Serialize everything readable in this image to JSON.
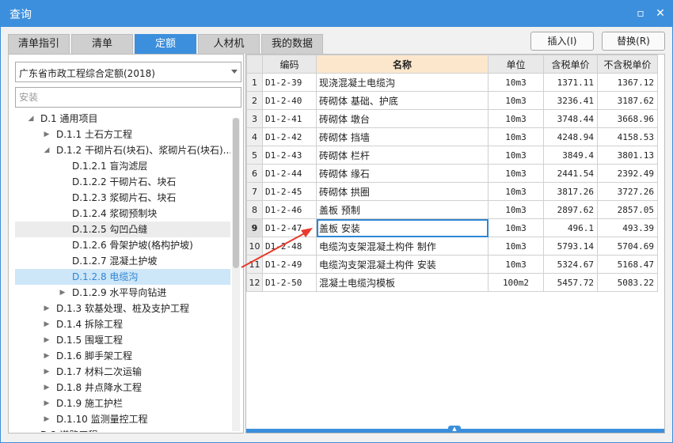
{
  "window": {
    "title": "查询",
    "minimize_glyph": "▫",
    "close_glyph": "✕"
  },
  "tabs": [
    "清单指引",
    "清单",
    "定额",
    "人材机",
    "我的数据"
  ],
  "active_tab": "定额",
  "buttons": {
    "insert": "插入(I)",
    "replace": "替换(R)"
  },
  "quota_library": {
    "selected": "广东省市政工程综合定额(2018)"
  },
  "search": {
    "placeholder": "安装",
    "value": ""
  },
  "tree": [
    {
      "label": "D.1 通用项目",
      "level": 0,
      "toggle": "expanded"
    },
    {
      "label": "D.1.1 土石方工程",
      "level": 1,
      "toggle": "collapsed"
    },
    {
      "label": "D.1.2 干砌片石(块石)、浆砌片石(块石)...",
      "level": 1,
      "toggle": "expanded"
    },
    {
      "label": "D.1.2.1 盲沟滤层",
      "level": 2,
      "toggle": "none"
    },
    {
      "label": "D.1.2.2 干砌片石、块石",
      "level": 2,
      "toggle": "none"
    },
    {
      "label": "D.1.2.3 浆砌片石、块石",
      "level": 2,
      "toggle": "none"
    },
    {
      "label": "D.1.2.4 浆砌预制块",
      "level": 2,
      "toggle": "none"
    },
    {
      "label": "D.1.2.5 勾凹凸缝",
      "level": 2,
      "toggle": "none",
      "state": "hover"
    },
    {
      "label": "D.1.2.6 骨架护坡(格构护坡)",
      "level": 2,
      "toggle": "none"
    },
    {
      "label": "D.1.2.7 混凝土护坡",
      "level": 2,
      "toggle": "none"
    },
    {
      "label": "D.1.2.8 电缆沟",
      "level": 2,
      "toggle": "none",
      "state": "selected"
    },
    {
      "label": "D.1.2.9 水平导向钻进",
      "level": 2,
      "toggle": "collapsed"
    },
    {
      "label": "D.1.3 软基处理、桩及支护工程",
      "level": 1,
      "toggle": "collapsed"
    },
    {
      "label": "D.1.4 拆除工程",
      "level": 1,
      "toggle": "collapsed"
    },
    {
      "label": "D.1.5 围堰工程",
      "level": 1,
      "toggle": "collapsed"
    },
    {
      "label": "D.1.6 脚手架工程",
      "level": 1,
      "toggle": "collapsed"
    },
    {
      "label": "D.1.7 材料二次运输",
      "level": 1,
      "toggle": "collapsed"
    },
    {
      "label": "D.1.8 井点降水工程",
      "level": 1,
      "toggle": "collapsed"
    },
    {
      "label": "D.1.9 施工护栏",
      "level": 1,
      "toggle": "collapsed"
    },
    {
      "label": "D.1.10 监测量控工程",
      "level": 1,
      "toggle": "collapsed"
    },
    {
      "label": "D.2 道路工程",
      "level": 0,
      "toggle": "expanded"
    }
  ],
  "table": {
    "columns": [
      "编码",
      "名称",
      "单位",
      "含税单价",
      "不含税单价"
    ],
    "sorted_column": "名称",
    "current_row": 9,
    "rows": [
      {
        "no": "1",
        "code": "D1-2-39",
        "name": "现浇混凝土电缆沟",
        "unit": "10m3",
        "price_tax": "1371.11",
        "price_notax": "1367.12"
      },
      {
        "no": "2",
        "code": "D1-2-40",
        "name": "砖砌体 基础、护底",
        "unit": "10m3",
        "price_tax": "3236.41",
        "price_notax": "3187.62"
      },
      {
        "no": "3",
        "code": "D1-2-41",
        "name": "砖砌体 墩台",
        "unit": "10m3",
        "price_tax": "3748.44",
        "price_notax": "3668.96"
      },
      {
        "no": "4",
        "code": "D1-2-42",
        "name": "砖砌体 挡墙",
        "unit": "10m3",
        "price_tax": "4248.94",
        "price_notax": "4158.53"
      },
      {
        "no": "5",
        "code": "D1-2-43",
        "name": "砖砌体 栏杆",
        "unit": "10m3",
        "price_tax": "3849.4",
        "price_notax": "3801.13"
      },
      {
        "no": "6",
        "code": "D1-2-44",
        "name": "砖砌体 缘石",
        "unit": "10m3",
        "price_tax": "2441.54",
        "price_notax": "2392.49"
      },
      {
        "no": "7",
        "code": "D1-2-45",
        "name": "砖砌体 拱圈",
        "unit": "10m3",
        "price_tax": "3817.26",
        "price_notax": "3727.26"
      },
      {
        "no": "8",
        "code": "D1-2-46",
        "name": "盖板 预制",
        "unit": "10m3",
        "price_tax": "2897.62",
        "price_notax": "2857.05"
      },
      {
        "no": "9",
        "code": "D1-2-47",
        "name": "盖板 安装",
        "unit": "10m3",
        "price_tax": "496.1",
        "price_notax": "493.39"
      },
      {
        "no": "10",
        "code": "D1-2-48",
        "name": "电缆沟支架混凝土构件 制作",
        "unit": "10m3",
        "price_tax": "5793.14",
        "price_notax": "5704.69"
      },
      {
        "no": "11",
        "code": "D1-2-49",
        "name": "电缆沟支架混凝土构件 安装",
        "unit": "10m3",
        "price_tax": "5324.67",
        "price_notax": "5168.47"
      },
      {
        "no": "12",
        "code": "D1-2-50",
        "name": "混凝土电缆沟模板",
        "unit": "100m2",
        "price_tax": "5457.72",
        "price_notax": "5083.22"
      }
    ]
  },
  "colors": {
    "accent": "#3c8fdc",
    "selection": "#cde6f8",
    "sorted_header": "#fde7cc",
    "annotation_arrow": "#e8392a"
  }
}
